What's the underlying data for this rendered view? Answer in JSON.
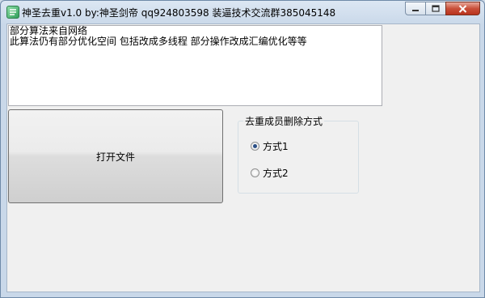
{
  "window": {
    "title": "神圣去重v1.0 by:神圣剑帝 qq924803598 装逼技术交流群385045148"
  },
  "log": {
    "lines": "部分算法来自网络\n此算法仍有部分优化空间 包括改成多线程 部分操作改成汇编优化等等"
  },
  "open_button": {
    "label": "打开文件"
  },
  "delete_mode": {
    "legend": "去重成员删除方式",
    "options": [
      {
        "label": "方式1",
        "checked": true
      },
      {
        "label": "方式2",
        "checked": false
      }
    ]
  },
  "icons": {
    "app": "app-icon",
    "minimize": "minimize-icon",
    "maximize": "maximize-icon",
    "close": "close-icon"
  }
}
